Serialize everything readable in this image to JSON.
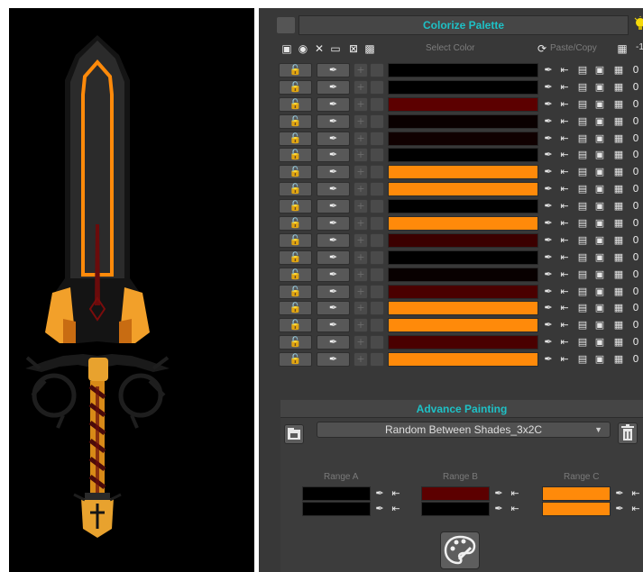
{
  "panel": {
    "title": "Colorize Palette",
    "toolbar": {
      "select_color_label": "Select Color",
      "paste_copy_label": "Paste/Copy",
      "value_label": "-1",
      "icons": [
        "lock-icon",
        "eye-icon",
        "close-icon",
        "frame-icon",
        "grid-cross-icon",
        "gradient-icon",
        "refresh-icon",
        "checker-icon"
      ]
    }
  },
  "rows": [
    {
      "color": "#000000",
      "value": "0"
    },
    {
      "color": "#000000",
      "value": "0"
    },
    {
      "color": "#5c0000",
      "value": "0"
    },
    {
      "color": "#0a0000",
      "value": "0"
    },
    {
      "color": "#100000",
      "value": "0"
    },
    {
      "color": "#000000",
      "value": "0"
    },
    {
      "color": "#ff8a0a",
      "value": "0"
    },
    {
      "color": "#ff8a0a",
      "value": "0"
    },
    {
      "color": "#000000",
      "value": "0"
    },
    {
      "color": "#ff8a0a",
      "value": "0"
    },
    {
      "color": "#3b0000",
      "value": "0"
    },
    {
      "color": "#000000",
      "value": "0"
    },
    {
      "color": "#080000",
      "value": "0"
    },
    {
      "color": "#4a0000",
      "value": "0"
    },
    {
      "color": "#ff8a0a",
      "value": "0"
    },
    {
      "color": "#ff8a0a",
      "value": "0"
    },
    {
      "color": "#4a0000",
      "value": "0"
    },
    {
      "color": "#ff8a0a",
      "value": "0"
    }
  ],
  "advance": {
    "title": "Advance Painting",
    "dropdown_value": "Random Between Shades_3x2C",
    "ranges": [
      {
        "label": "Range A",
        "colors": [
          "#000000",
          "#000000"
        ]
      },
      {
        "label": "Range B",
        "colors": [
          "#5c0000",
          "#000000"
        ]
      },
      {
        "label": "Range C",
        "colors": [
          "#ff8a0a",
          "#ff8a0a"
        ]
      }
    ]
  },
  "colors": {
    "accent": "#1ec1c6",
    "orange": "#ff8a0a",
    "panel_bg": "#383838"
  }
}
